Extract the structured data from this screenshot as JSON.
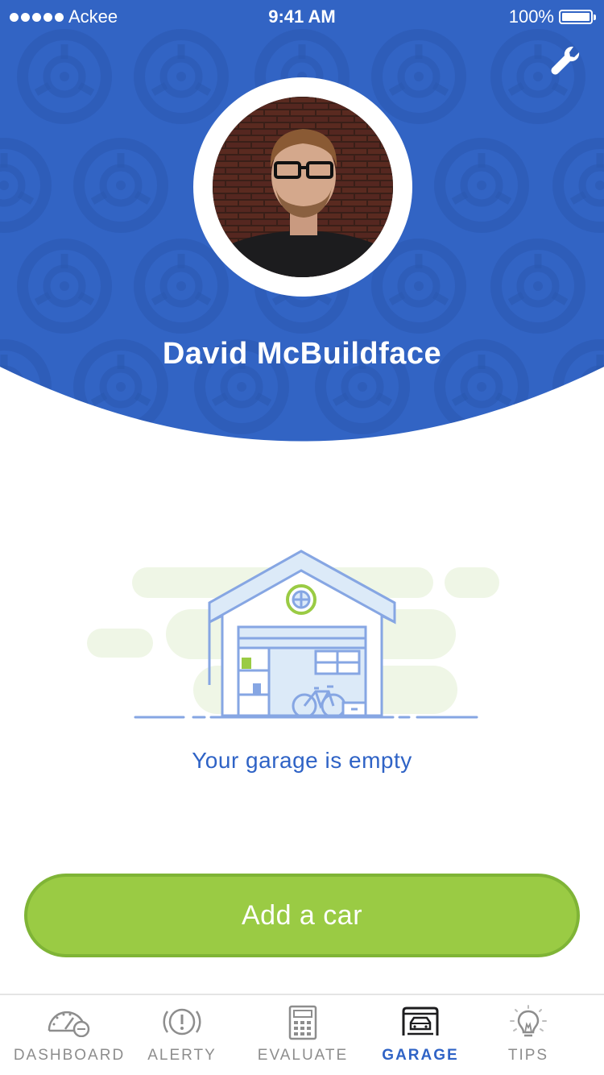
{
  "status_bar": {
    "carrier": "Ackee",
    "time": "9:41 AM",
    "battery": "100%"
  },
  "profile": {
    "name": "David McBuildface"
  },
  "garage": {
    "empty_message": "Your garage is empty",
    "add_button_label": "Add a car"
  },
  "tabs": [
    {
      "label": "DASHBOARD",
      "icon": "speedometer-icon",
      "active": false
    },
    {
      "label": "ALERTY",
      "icon": "alert-icon",
      "active": false
    },
    {
      "label": "EVALUATE",
      "icon": "calculator-icon",
      "active": false
    },
    {
      "label": "GARAGE",
      "icon": "garage-car-icon",
      "active": true
    },
    {
      "label": "TIPS",
      "icon": "lightbulb-icon",
      "active": false
    }
  ],
  "colors": {
    "header_blue": "#3264c4",
    "accent_blue": "#2f63c6",
    "button_green": "#9acb44",
    "button_border_green": "#7fb436",
    "tab_inactive": "#8d8d8d"
  }
}
